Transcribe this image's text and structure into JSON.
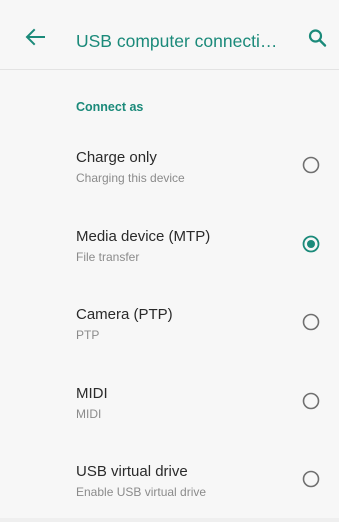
{
  "appbar": {
    "title": "USB computer connecti…",
    "back_icon": "arrow-back-icon",
    "search_icon": "search-icon",
    "accent_color": "#1b8a7a"
  },
  "section": {
    "header": "Connect as"
  },
  "options": [
    {
      "title": "Charge only",
      "subtitle": "Charging this device",
      "selected": false
    },
    {
      "title": "Media device (MTP)",
      "subtitle": "File transfer",
      "selected": true
    },
    {
      "title": "Camera (PTP)",
      "subtitle": "PTP",
      "selected": false
    },
    {
      "title": "MIDI",
      "subtitle": "MIDI",
      "selected": false
    },
    {
      "title": "USB virtual drive",
      "subtitle": "Enable USB virtual drive",
      "selected": false
    }
  ]
}
